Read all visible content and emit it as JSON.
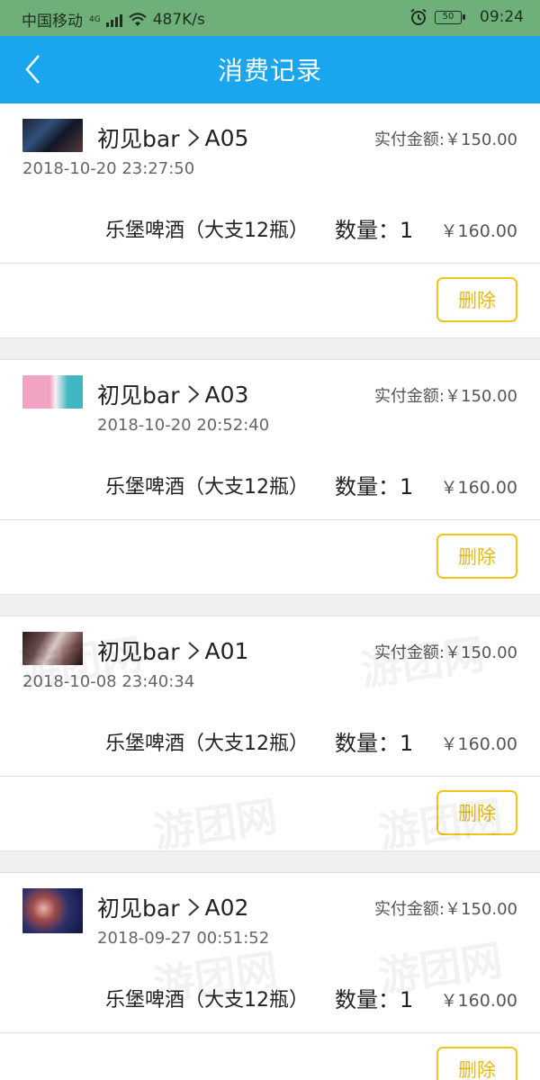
{
  "status_bar": {
    "carrier": "中国移动",
    "network_badge": "4G",
    "speed": "487K/s",
    "battery": "50",
    "time": "09:24"
  },
  "header": {
    "title": "消费记录",
    "back_icon": "chevron-left-icon"
  },
  "records": [
    {
      "store": "初见bar",
      "table": "A05",
      "paid_label": "实付金额:",
      "paid_amount": "￥150.00",
      "datetime": "2018-10-20 23:27:50",
      "item_name": "乐堡啤酒（大支12瓶）",
      "quantity_label": "数量：",
      "quantity": "1",
      "price": "￥160.00",
      "delete_label": "删除"
    },
    {
      "store": "初见bar",
      "table": "A03",
      "paid_label": "实付金额:",
      "paid_amount": "￥150.00",
      "datetime": "2018-10-20 20:52:40",
      "item_name": "乐堡啤酒（大支12瓶）",
      "quantity_label": "数量：",
      "quantity": "1",
      "price": "￥160.00",
      "delete_label": "删除"
    },
    {
      "store": "初见bar",
      "table": "A01",
      "paid_label": "实付金额:",
      "paid_amount": "￥150.00",
      "datetime": "2018-10-08 23:40:34",
      "item_name": "乐堡啤酒（大支12瓶）",
      "quantity_label": "数量：",
      "quantity": "1",
      "price": "￥160.00",
      "delete_label": "删除"
    },
    {
      "store": "初见bar",
      "table": "A02",
      "paid_label": "实付金额:",
      "paid_amount": "￥150.00",
      "datetime": "2018-09-27 00:51:52",
      "item_name": "乐堡啤酒（大支12瓶）",
      "quantity_label": "数量：",
      "quantity": "1",
      "price": "￥160.00",
      "delete_label": "删除"
    }
  ],
  "watermark_text": "游团网",
  "colors": {
    "status_bar": "#6fb07a",
    "header": "#1aa6ef",
    "delete_border": "#f0c419",
    "delete_text": "#e8b913",
    "separator": "#f0f0f0"
  }
}
